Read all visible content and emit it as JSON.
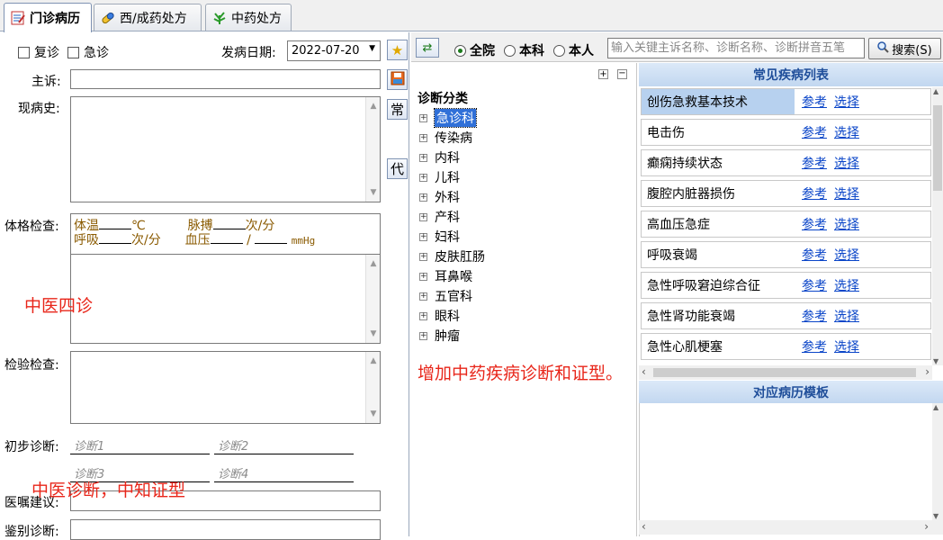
{
  "tabs": [
    {
      "label": "门诊病历",
      "icon": "notebook-icon",
      "active": true
    },
    {
      "label": "西/成药处方",
      "icon": "capsule-icon",
      "active": false
    },
    {
      "label": "中药处方",
      "icon": "herb-icon",
      "active": false
    }
  ],
  "form": {
    "revisit_label": "复诊",
    "emergency_label": "急诊",
    "onset_label": "发病日期:",
    "onset_value": "2022-07-20",
    "chief_complaint_label": "主诉:",
    "present_illness_label": "现病史:",
    "physical_exam_label": "体格检查:",
    "vitals": {
      "temp_label": "体温",
      "temp_unit": "℃",
      "pulse_label": "脉搏",
      "pulse_unit": "次/分",
      "resp_label": "呼吸",
      "resp_unit": "次/分",
      "bp_label": "血压",
      "bp_sep": "/",
      "bp_unit": "mmHg"
    },
    "lab_exam_label": "检验检查:",
    "prelim_diag_label": "初步诊断:",
    "diag_placeholders": [
      "诊断1",
      "诊断2",
      "诊断3",
      "诊断4"
    ],
    "advice_label": "医嘱建议:",
    "differential_label": "鉴别诊断:"
  },
  "annotations": {
    "tcm_four": "中医四诊",
    "tcm_diag": "中医诊断，中知证型",
    "add_tcm": "增加中药疾病诊断和证型。"
  },
  "side_buttons": {
    "common": "常",
    "proxy": "代"
  },
  "filter": {
    "options": [
      "全院",
      "本科",
      "本人"
    ],
    "selected": "全院",
    "search_placeholder": "输入关键主诉名称、诊断名称、诊断拼音五笔",
    "search_button": "搜索(S)"
  },
  "tree": {
    "title": "诊断分类",
    "selected": "急诊科",
    "nodes": [
      "急诊科",
      "传染病",
      "内科",
      "儿科",
      "外科",
      "产科",
      "妇科",
      "皮肤肛肠",
      "耳鼻喉",
      "五官科",
      "眼科",
      "肿瘤"
    ]
  },
  "disease_list": {
    "title": "常见疾病列表",
    "ref_label": "参考",
    "select_label": "选择",
    "items": [
      "创伤急救基本技术",
      "电击伤",
      "癫痫持续状态",
      "腹腔内脏器损伤",
      "高血压急症",
      "呼吸衰竭",
      "急性呼吸窘迫综合征",
      "急性肾功能衰竭",
      "急性心肌梗塞"
    ]
  },
  "template_panel": {
    "title": "对应病历模板"
  },
  "colors": {
    "annotation": "#e8261a",
    "link": "#0a45c8",
    "selected_row": "#b7d1ef",
    "header_text": "#1f4e9a"
  }
}
